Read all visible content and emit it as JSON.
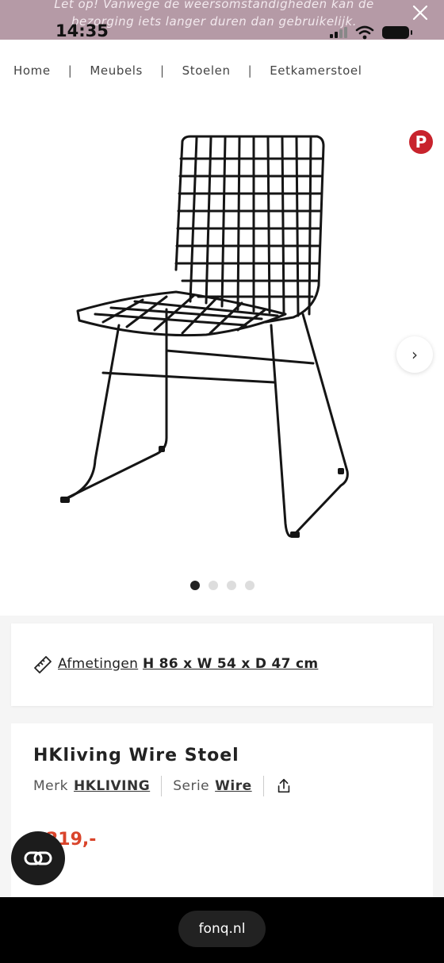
{
  "banner": {
    "text": "Let op! Vanwege de weersomstandigheden kan de bezorging iets langer duren dan gebruikelijk."
  },
  "status": {
    "time": "14:35"
  },
  "breadcrumb": [
    "Home",
    "Meubels",
    "Stoelen",
    "Eetkamerstoel"
  ],
  "gallery": {
    "slide_count": 4,
    "active_index": 0
  },
  "dimensions": {
    "label": "Afmetingen",
    "value": "H 86 x W 54 x D 47 cm"
  },
  "product": {
    "title": "HKliving Wire Stoel",
    "brand_label": "Merk",
    "brand": "HKLIVING",
    "series_label": "Serie",
    "series": "Wire",
    "price": "219,-"
  },
  "browser": {
    "url": "fonq.nl"
  },
  "icons": [
    "close-icon",
    "pinterest-icon",
    "chevron-right-icon",
    "ruler-icon",
    "share-icon",
    "compare-icon"
  ],
  "colors": {
    "banner": "#b59aa6",
    "price": "#d9442b",
    "pinterest": "#c8232c"
  }
}
